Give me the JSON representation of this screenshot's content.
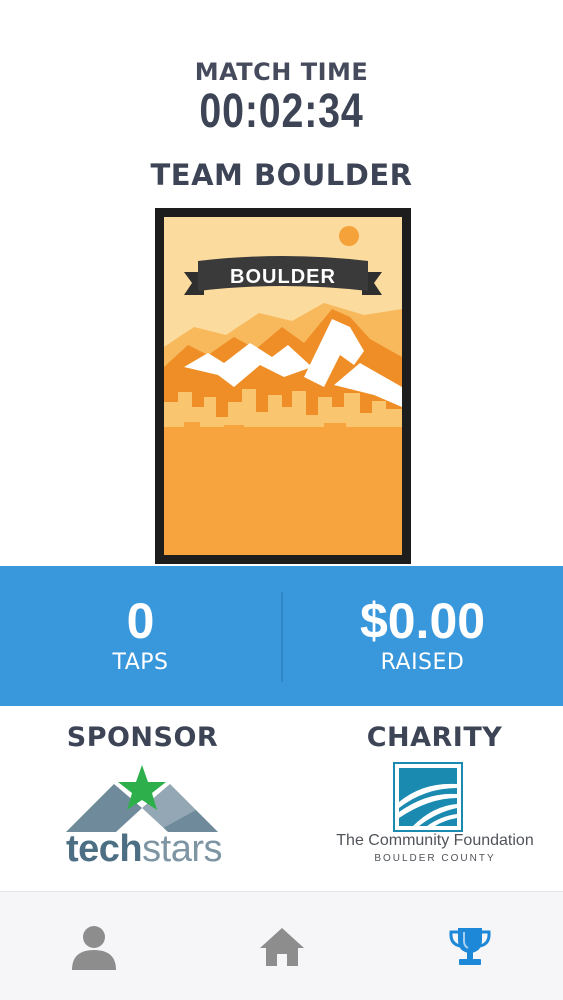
{
  "header": {
    "match_label": "MATCH TIME",
    "match_time": "00:02:34",
    "team_name": "TEAM BOULDER"
  },
  "poster": {
    "banner_text": "BOULDER",
    "colors": {
      "sky": "#fbdb9e",
      "ground": "#f7a43e",
      "orange": "#ef8e26",
      "frame": "#1d1d1d"
    }
  },
  "stats": {
    "taps_value": "0",
    "taps_label": "TAPS",
    "raised_value": "$0.00",
    "raised_label": "RAISED",
    "background": "#3997dc"
  },
  "sponsor": {
    "title": "SPONSOR",
    "logo_word_1": "tech",
    "logo_word_2": "stars"
  },
  "charity": {
    "title": "CHARITY",
    "name": "The Community Foundation",
    "subtitle": "BOULDER COUNTY"
  },
  "tabbar": {
    "items": [
      {
        "icon": "person-icon",
        "active": false
      },
      {
        "icon": "home-icon",
        "active": false
      },
      {
        "icon": "trophy-icon",
        "active": true
      }
    ],
    "active_color": "#1e88d8",
    "inactive_color": "#8d8d8d"
  }
}
